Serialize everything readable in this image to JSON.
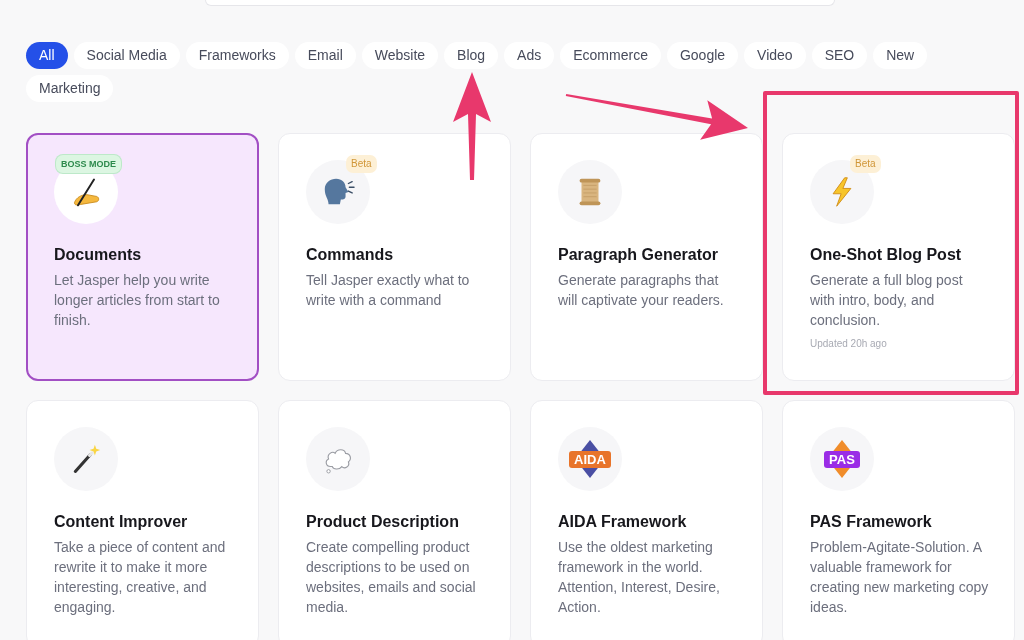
{
  "filters": [
    {
      "label": "All",
      "selected": true
    },
    {
      "label": "Social Media",
      "selected": false
    },
    {
      "label": "Frameworks",
      "selected": false
    },
    {
      "label": "Email",
      "selected": false
    },
    {
      "label": "Website",
      "selected": false
    },
    {
      "label": "Blog",
      "selected": false
    },
    {
      "label": "Ads",
      "selected": false
    },
    {
      "label": "Ecommerce",
      "selected": false
    },
    {
      "label": "Google",
      "selected": false
    },
    {
      "label": "Video",
      "selected": false
    },
    {
      "label": "SEO",
      "selected": false
    },
    {
      "label": "New",
      "selected": false
    },
    {
      "label": "Marketing",
      "selected": false
    }
  ],
  "cards": [
    {
      "kind": "emoji",
      "title": "Documents",
      "description": "Let Jasper help you write longer articles from start to finish.",
      "selected": true,
      "highlighted": false,
      "badge": {
        "kind": "boss",
        "text": "BOSS MODE"
      }
    },
    {
      "kind": "emoji",
      "title": "Commands",
      "description": "Tell Jasper exactly what to write with a command",
      "selected": false,
      "highlighted": false,
      "badge": {
        "kind": "beta",
        "text": "Beta"
      }
    },
    {
      "kind": "emoji",
      "title": "Paragraph Generator",
      "description": "Generate paragraphs that will captivate your readers.",
      "selected": false,
      "highlighted": false
    },
    {
      "kind": "emoji",
      "title": "One-Shot Blog Post",
      "description": "Generate a full blog post with intro, body, and conclusion.",
      "selected": false,
      "highlighted": true,
      "badge": {
        "kind": "beta",
        "text": "Beta"
      },
      "updated": "Updated 20h ago"
    },
    {
      "kind": "emoji",
      "title": "Content Improver",
      "description": "Take a piece of content and rewrite it to make it more interesting, creative, and engaging.",
      "selected": false,
      "highlighted": false
    },
    {
      "kind": "emoji",
      "title": "Product Description",
      "description": "Create compelling product descriptions to be used on websites, emails and social media.",
      "selected": false,
      "highlighted": false
    },
    {
      "kind": "logo",
      "logo": "AIDA",
      "title": "AIDA Framework",
      "description": "Use the oldest marketing framework in the world. Attention, Interest, Desire, Action.",
      "selected": false,
      "highlighted": false
    },
    {
      "kind": "logo",
      "logo": "PAS",
      "title": "PAS Framework",
      "description": "Problem-Agitate-Solution. A valuable framework for creating new marketing copy ideas.",
      "selected": false,
      "highlighted": false
    }
  ]
}
